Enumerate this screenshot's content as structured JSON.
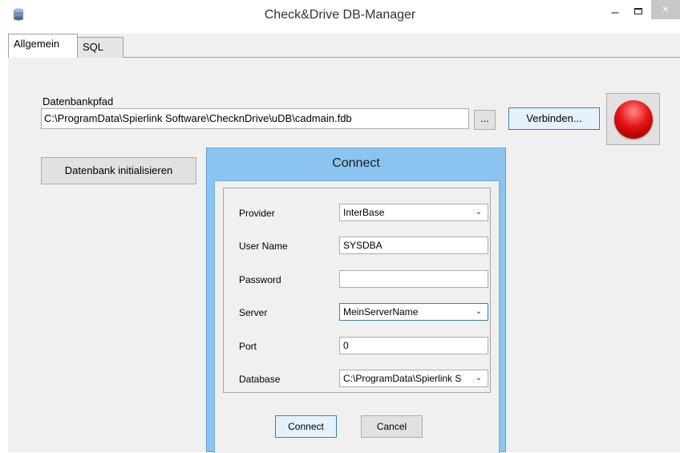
{
  "window": {
    "title": "Check&Drive DB-Manager",
    "minimize_glyph": "–",
    "close_glyph": "×"
  },
  "tabs": [
    {
      "label": "Allgemein",
      "active": true
    },
    {
      "label": "SQL",
      "active": false
    }
  ],
  "main": {
    "path_label": "Datenbankpfad",
    "path_value": "C:\\ProgramData\\Spierlink Software\\ChecknDrive\\uDB\\cadmain.fdb",
    "browse_label": "...",
    "connect_label": "Verbinden...",
    "init_label": "Datenbank initialisieren",
    "status_color": "#e41414"
  },
  "dialog": {
    "title": "Connect",
    "fields": [
      {
        "label": "Provider",
        "value": "InterBase",
        "type": "select"
      },
      {
        "label": "User Name",
        "value": "SYSDBA",
        "type": "text"
      },
      {
        "label": "Password",
        "value": "",
        "type": "password"
      },
      {
        "label": "Server",
        "value": "MeinServerName",
        "type": "select"
      },
      {
        "label": "Port",
        "value": "0",
        "type": "text"
      },
      {
        "label": "Database",
        "value": "C:\\ProgramData\\Spierlink S",
        "type": "select"
      }
    ],
    "connect_label": "Connect",
    "cancel_label": "Cancel"
  },
  "colors": {
    "dialog_frame": "#8bc4f0",
    "default_button": "#e5f1fb",
    "default_button_border": "#3c7fb1"
  },
  "icons": {
    "app": "database-icon",
    "dropdown": "chevron-down-icon",
    "status": "status-light-icon"
  }
}
